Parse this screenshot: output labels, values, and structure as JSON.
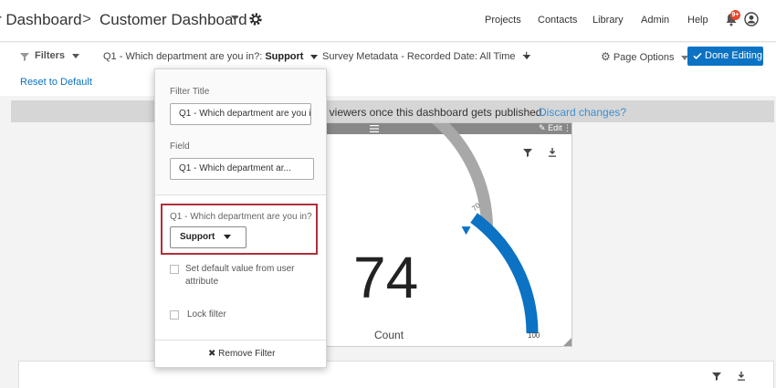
{
  "header": {
    "breadcrumb_parent": "r Dashboard",
    "breadcrumb_separator": ">",
    "dashboard_title": "Customer Dashboard",
    "nav": [
      "Projects",
      "Contacts",
      "Library",
      "Admin",
      "Help"
    ],
    "notification_count": "9+"
  },
  "filterbar": {
    "filters_label": "Filters",
    "filter1_prefix": "Q1 - Which department are you in?:",
    "filter1_value": "Support",
    "filter2_label": "Survey Metadata - Recorded Date: All Time",
    "add_label": "+",
    "page_options_label": "Page Options",
    "done_label": "Done Editing",
    "reset_label": "Reset to Default"
  },
  "banner": {
    "text": "ll viewers once this dashboard gets published.",
    "discard_label": "Discard changes?"
  },
  "widget": {
    "edit_label": "Edit",
    "metric_label": "Count",
    "gauge": {
      "value": 74,
      "target": 70,
      "min": 0,
      "max": 100,
      "target_label": "70",
      "max_label": "100",
      "value_label": "74"
    },
    "colors": {
      "fill": "#0b72c4",
      "track": "#a8a8a8",
      "target_marker": "#0b72c4"
    }
  },
  "popover": {
    "filter_title_label": "Filter Title",
    "filter_title_value": "Q1 - Which department are you in?",
    "field_label": "Field",
    "field_value": "Q1 - Which department ar...",
    "question_label": "Q1 - Which department are you in?",
    "selected_value": "Support",
    "default_attr_line1": "Set default value from user",
    "default_attr_line2": "attribute",
    "lock_label": "Lock filter",
    "remove_label": "Remove Filter"
  }
}
